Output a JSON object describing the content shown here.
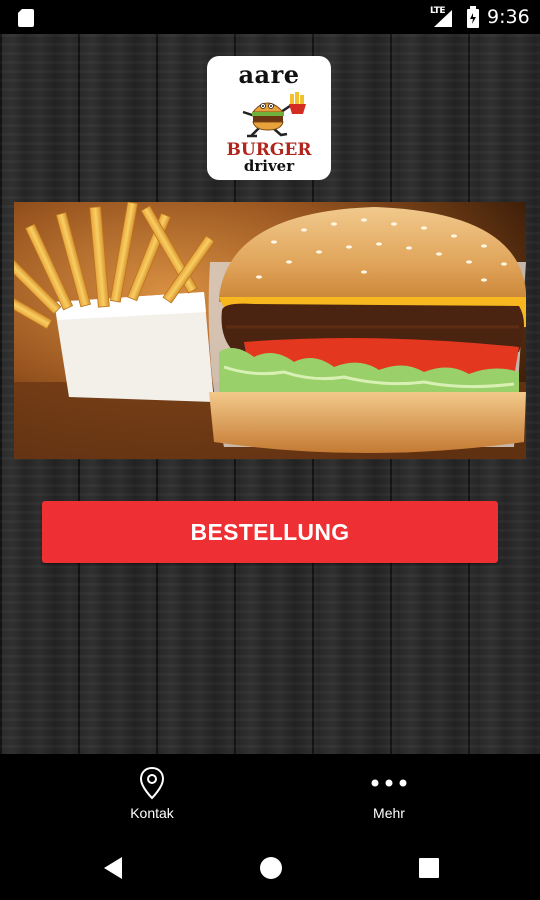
{
  "status_bar": {
    "network": "LTE",
    "time": "9:36",
    "icons": [
      "sd-card-icon",
      "signal-icon",
      "battery-icon"
    ]
  },
  "logo": {
    "line1": "aare",
    "line2": "BURGER",
    "line3": "driver",
    "accent_color": "#b0241c"
  },
  "hero": {
    "icon": "burger-and-fries-photo"
  },
  "order_button": {
    "label": "BESTELLUNG",
    "color": "#ee2f33"
  },
  "tabs": [
    {
      "label": "Kontak",
      "icon": "location-pin-icon"
    },
    {
      "label": "Mehr",
      "icon": "more-dots-icon"
    }
  ],
  "nav": {
    "icons": [
      "back-icon",
      "home-icon",
      "recent-apps-icon"
    ]
  }
}
